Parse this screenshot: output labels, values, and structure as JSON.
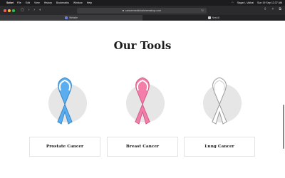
{
  "menubar": {
    "app": "Safari",
    "items": [
      "File",
      "Edit",
      "View",
      "History",
      "Bookmarks",
      "Window",
      "Help"
    ],
    "user": "Sagar L Vaibal",
    "datetime": "Sun 19 Sep  12:37 AM"
  },
  "toolbar": {
    "url": "cancermedicinalchemshop.com"
  },
  "tabs": [
    {
      "label": "Website"
    },
    {
      "label": "Nest AI"
    }
  ],
  "section": {
    "title": "Our Tools"
  },
  "tools": [
    {
      "label": "Prostate Cancer",
      "ribbon_color": "#5aaef0"
    },
    {
      "label": "Breast Cancer",
      "ribbon_color": "#f27ea9"
    },
    {
      "label": "Lung Cancer",
      "ribbon_color": "#ffffff"
    }
  ],
  "colors": {
    "menubar_bg": "#1c1c1e",
    "toolbar_bg": "#2b2b2d",
    "circle_bg": "#e6e6e6"
  }
}
